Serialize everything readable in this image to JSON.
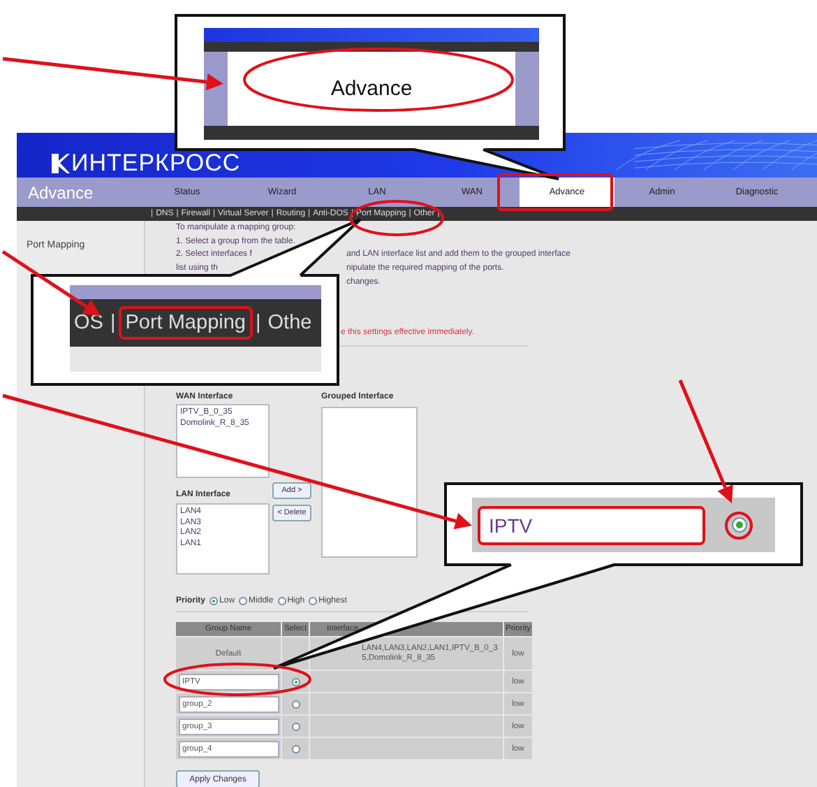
{
  "header": {
    "logo": "ИНТЕРКРОСС"
  },
  "nav": {
    "title": "Advance",
    "tabs": [
      {
        "label": "Status",
        "selected": false
      },
      {
        "label": "Wizard",
        "selected": false
      },
      {
        "label": "LAN",
        "selected": false
      },
      {
        "label": "WAN",
        "selected": false
      },
      {
        "label": "Advance",
        "selected": true
      },
      {
        "label": "Admin",
        "selected": false
      },
      {
        "label": "Diagnostic",
        "selected": false
      }
    ]
  },
  "subnav": {
    "separator": "|",
    "items": [
      "DNS",
      "Firewall",
      "Virtual Server",
      "Routing",
      "Anti-DOS",
      "Port Mapping",
      "Other"
    ]
  },
  "sidebar": {
    "items": [
      "Port Mapping"
    ]
  },
  "instructions": [
    {
      "before": "To manipulate a mapping group:"
    },
    {
      "before": "1. Select a group from the table."
    },
    {
      "before": "2. Select interfaces f",
      "after": "and LAN interface list and add them to the grouped interface"
    },
    {
      "before": "list using th",
      "after": "nipulate the required mapping of the ports."
    },
    {
      "after": "changes."
    }
  ],
  "note": "e this settings effective immediately.",
  "wan_interface": {
    "label": "WAN Interface",
    "items": [
      "IPTV_B_0_35",
      "Domolink_R_8_35"
    ]
  },
  "lan_interface": {
    "label": "LAN Interface",
    "items": [
      "LAN4",
      "LAN3",
      "LAN2",
      "LAN1"
    ]
  },
  "grouped_interface": {
    "label": "Grouped Interface"
  },
  "buttons": {
    "add": "Add >",
    "delete": "< Delete"
  },
  "priority": {
    "label": "Priority",
    "options": [
      {
        "label": "Low",
        "selected": true
      },
      {
        "label": "Middle",
        "selected": false
      },
      {
        "label": "High",
        "selected": false
      },
      {
        "label": "Highest",
        "selected": false
      }
    ]
  },
  "table": {
    "columns": [
      "Group Name",
      "Select",
      "Interface",
      "Priority"
    ],
    "rows": [
      {
        "kind": "default",
        "name": "Default",
        "interface": "LAN4,LAN3,LAN2,LAN1,IPTV_B_0_35,Domolink_R_8_35",
        "priority": "low"
      },
      {
        "kind": "group",
        "name": "IPTV",
        "selected": true,
        "priority": "low"
      },
      {
        "kind": "group",
        "name": "group_2",
        "selected": false,
        "priority": "low"
      },
      {
        "kind": "group",
        "name": "group_3",
        "selected": false,
        "priority": "low"
      },
      {
        "kind": "group",
        "name": "group_4",
        "selected": false,
        "priority": "low"
      }
    ]
  },
  "apply_button": "Apply Changes",
  "callouts": {
    "tab": "Advance",
    "menu": [
      "OS",
      "Port Mapping",
      "Othe"
    ],
    "menu_separator": "|",
    "field": "IPTV",
    "radio_selected": true
  }
}
